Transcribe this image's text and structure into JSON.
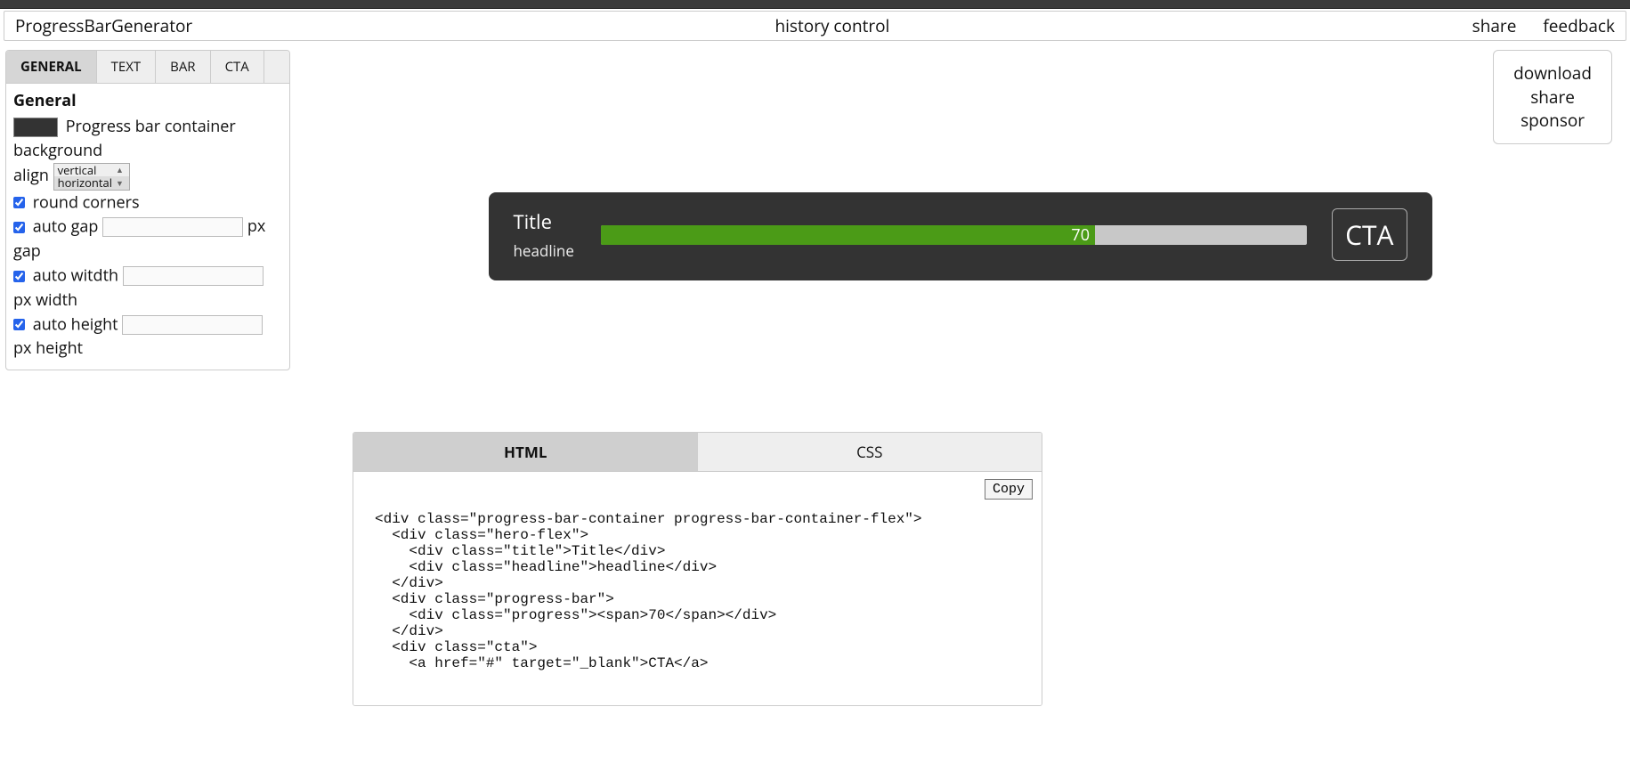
{
  "header": {
    "app_name": "ProgressBarGenerator",
    "center_label": "history control",
    "links": {
      "share": "share",
      "feedback": "feedback"
    }
  },
  "actions": {
    "download": "download",
    "share": "share",
    "sponsor": "sponsor"
  },
  "panel": {
    "tabs": {
      "general": "GENERAL",
      "text": "TEXT",
      "bar": "BAR",
      "cta": "CTA"
    },
    "active_tab": "general",
    "section_title": "General",
    "bg_label": "Progress bar container background",
    "bg_color": "#333333",
    "align_label": "align",
    "align_options": {
      "vertical": "vertical",
      "horizontal": "horizontal"
    },
    "align_selected": "horizontal",
    "round_corners_label": "round corners",
    "round_corners_checked": true,
    "auto_gap_label": "auto gap",
    "auto_gap_checked": true,
    "gap_suffix": "px gap",
    "gap_value": "",
    "auto_width_label": "auto witdth",
    "auto_width_checked": true,
    "width_suffix": "px width",
    "width_value": "",
    "auto_height_label": "auto height",
    "auto_height_checked": true,
    "height_suffix": "px height",
    "height_value": ""
  },
  "preview": {
    "title": "Title",
    "headline": "headline",
    "progress_value": "70",
    "cta_label": "CTA"
  },
  "code": {
    "tabs": {
      "html": "HTML",
      "css": "CSS"
    },
    "active_tab": "html",
    "copy_label": "Copy",
    "html_content": "\n<div class=\"progress-bar-container progress-bar-container-flex\">\n  <div class=\"hero-flex\">\n    <div class=\"title\">Title</div>\n    <div class=\"headline\">headline</div>\n  </div>\n  <div class=\"progress-bar\">\n    <div class=\"progress\"><span>70</span></div>\n  </div>\n  <div class=\"cta\">\n    <a href=\"#\" target=\"_blank\">CTA</a>"
  }
}
